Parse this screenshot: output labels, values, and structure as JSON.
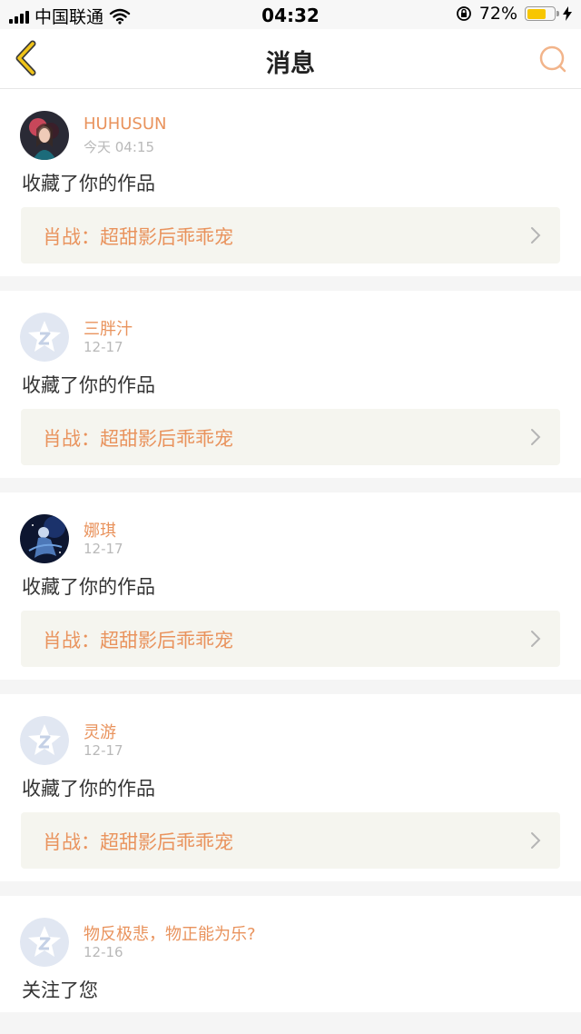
{
  "status_bar": {
    "carrier": "中国联通",
    "time": "04:32",
    "battery": "72%",
    "battery_level": 0.72,
    "icons": [
      "signal-icon",
      "wifi-icon",
      "orientation-lock-icon",
      "battery-icon",
      "charging-icon"
    ]
  },
  "nav": {
    "title": "消息",
    "back_icon": "back-chevron-icon",
    "search_icon": "search-icon"
  },
  "colors": {
    "accent": "#e9935d",
    "back_arrow": "#f0c419",
    "link_bg": "#f5f5ef"
  },
  "messages": [
    {
      "user": "HUHUSUN",
      "time": "今天 04:15",
      "action": "收藏了你的作品",
      "link": "肖战：超甜影后乖乖宠",
      "avatar": "photo"
    },
    {
      "user": "三胖汁",
      "time": "12-17",
      "action": "收藏了你的作品",
      "link": "肖战：超甜影后乖乖宠",
      "avatar": "default"
    },
    {
      "user": "娜琪",
      "time": "12-17",
      "action": "收藏了你的作品",
      "link": "肖战：超甜影后乖乖宠",
      "avatar": "photo"
    },
    {
      "user": "灵游",
      "time": "12-17",
      "action": "收藏了你的作品",
      "link": "肖战：超甜影后乖乖宠",
      "avatar": "default"
    },
    {
      "user": "物反极悲，物正能为乐?",
      "time": "12-16",
      "action": "关注了您",
      "avatar": "default"
    }
  ]
}
